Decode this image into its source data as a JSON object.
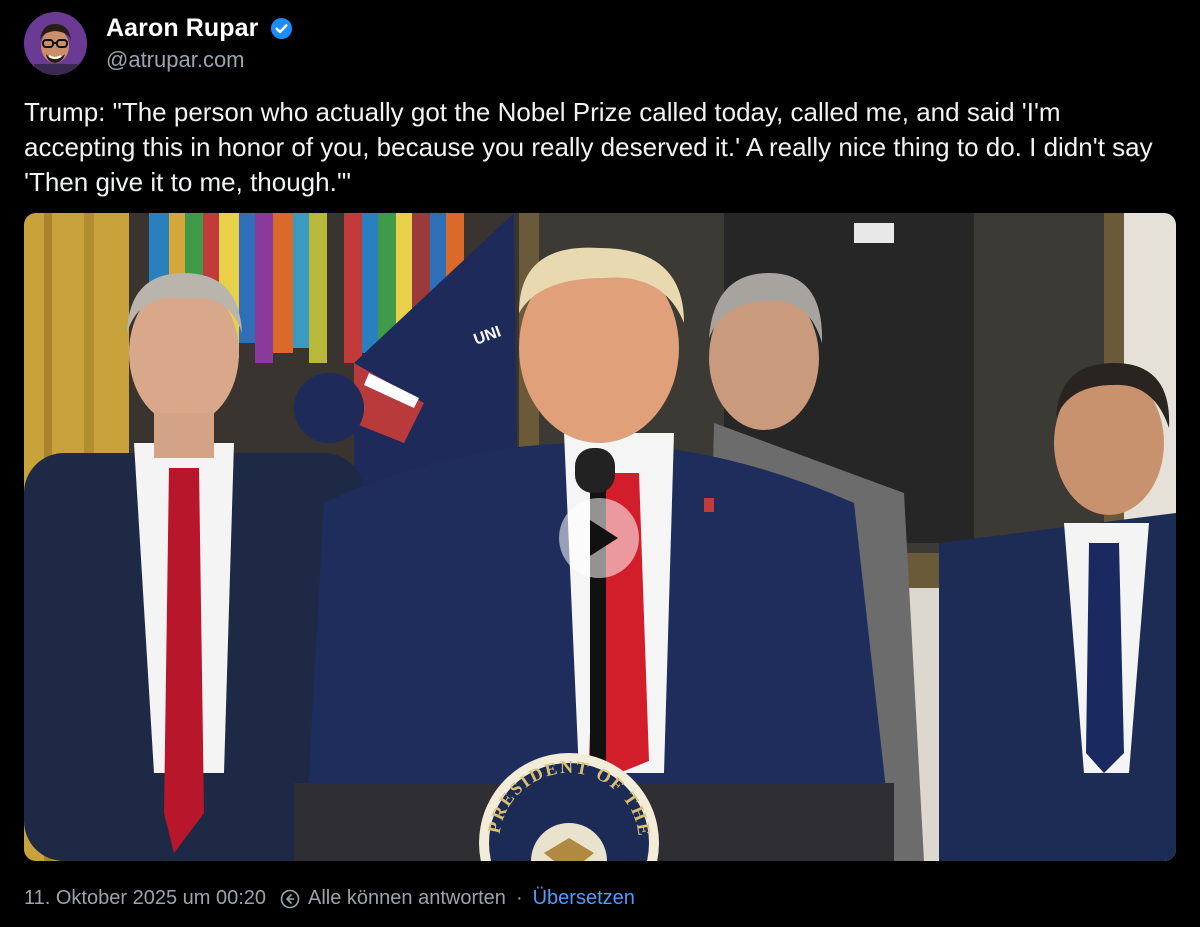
{
  "author": {
    "display_name": "Aaron Rupar",
    "handle": "@atrupar.com",
    "verified": true,
    "verified_color": "#1d8cff"
  },
  "post": {
    "text": "Trump: \"The person who actually got the Nobel Prize called today, called me, and said 'I'm accepting this in honor of you, because you really deserved it.' A really nice thing to do. I didn't say 'Then give it to me, though.'\""
  },
  "video": {
    "seal_text": "PRESIDENT OF THE UNITED",
    "flag_text": "UNI",
    "play_icon": "play-icon"
  },
  "footer": {
    "timestamp": "11. Oktober 2025 um 00:20",
    "reply_setting": "Alle können antworten",
    "separator": "·",
    "translate_label": "Übersetzen",
    "translate_color": "#4f9bff"
  }
}
